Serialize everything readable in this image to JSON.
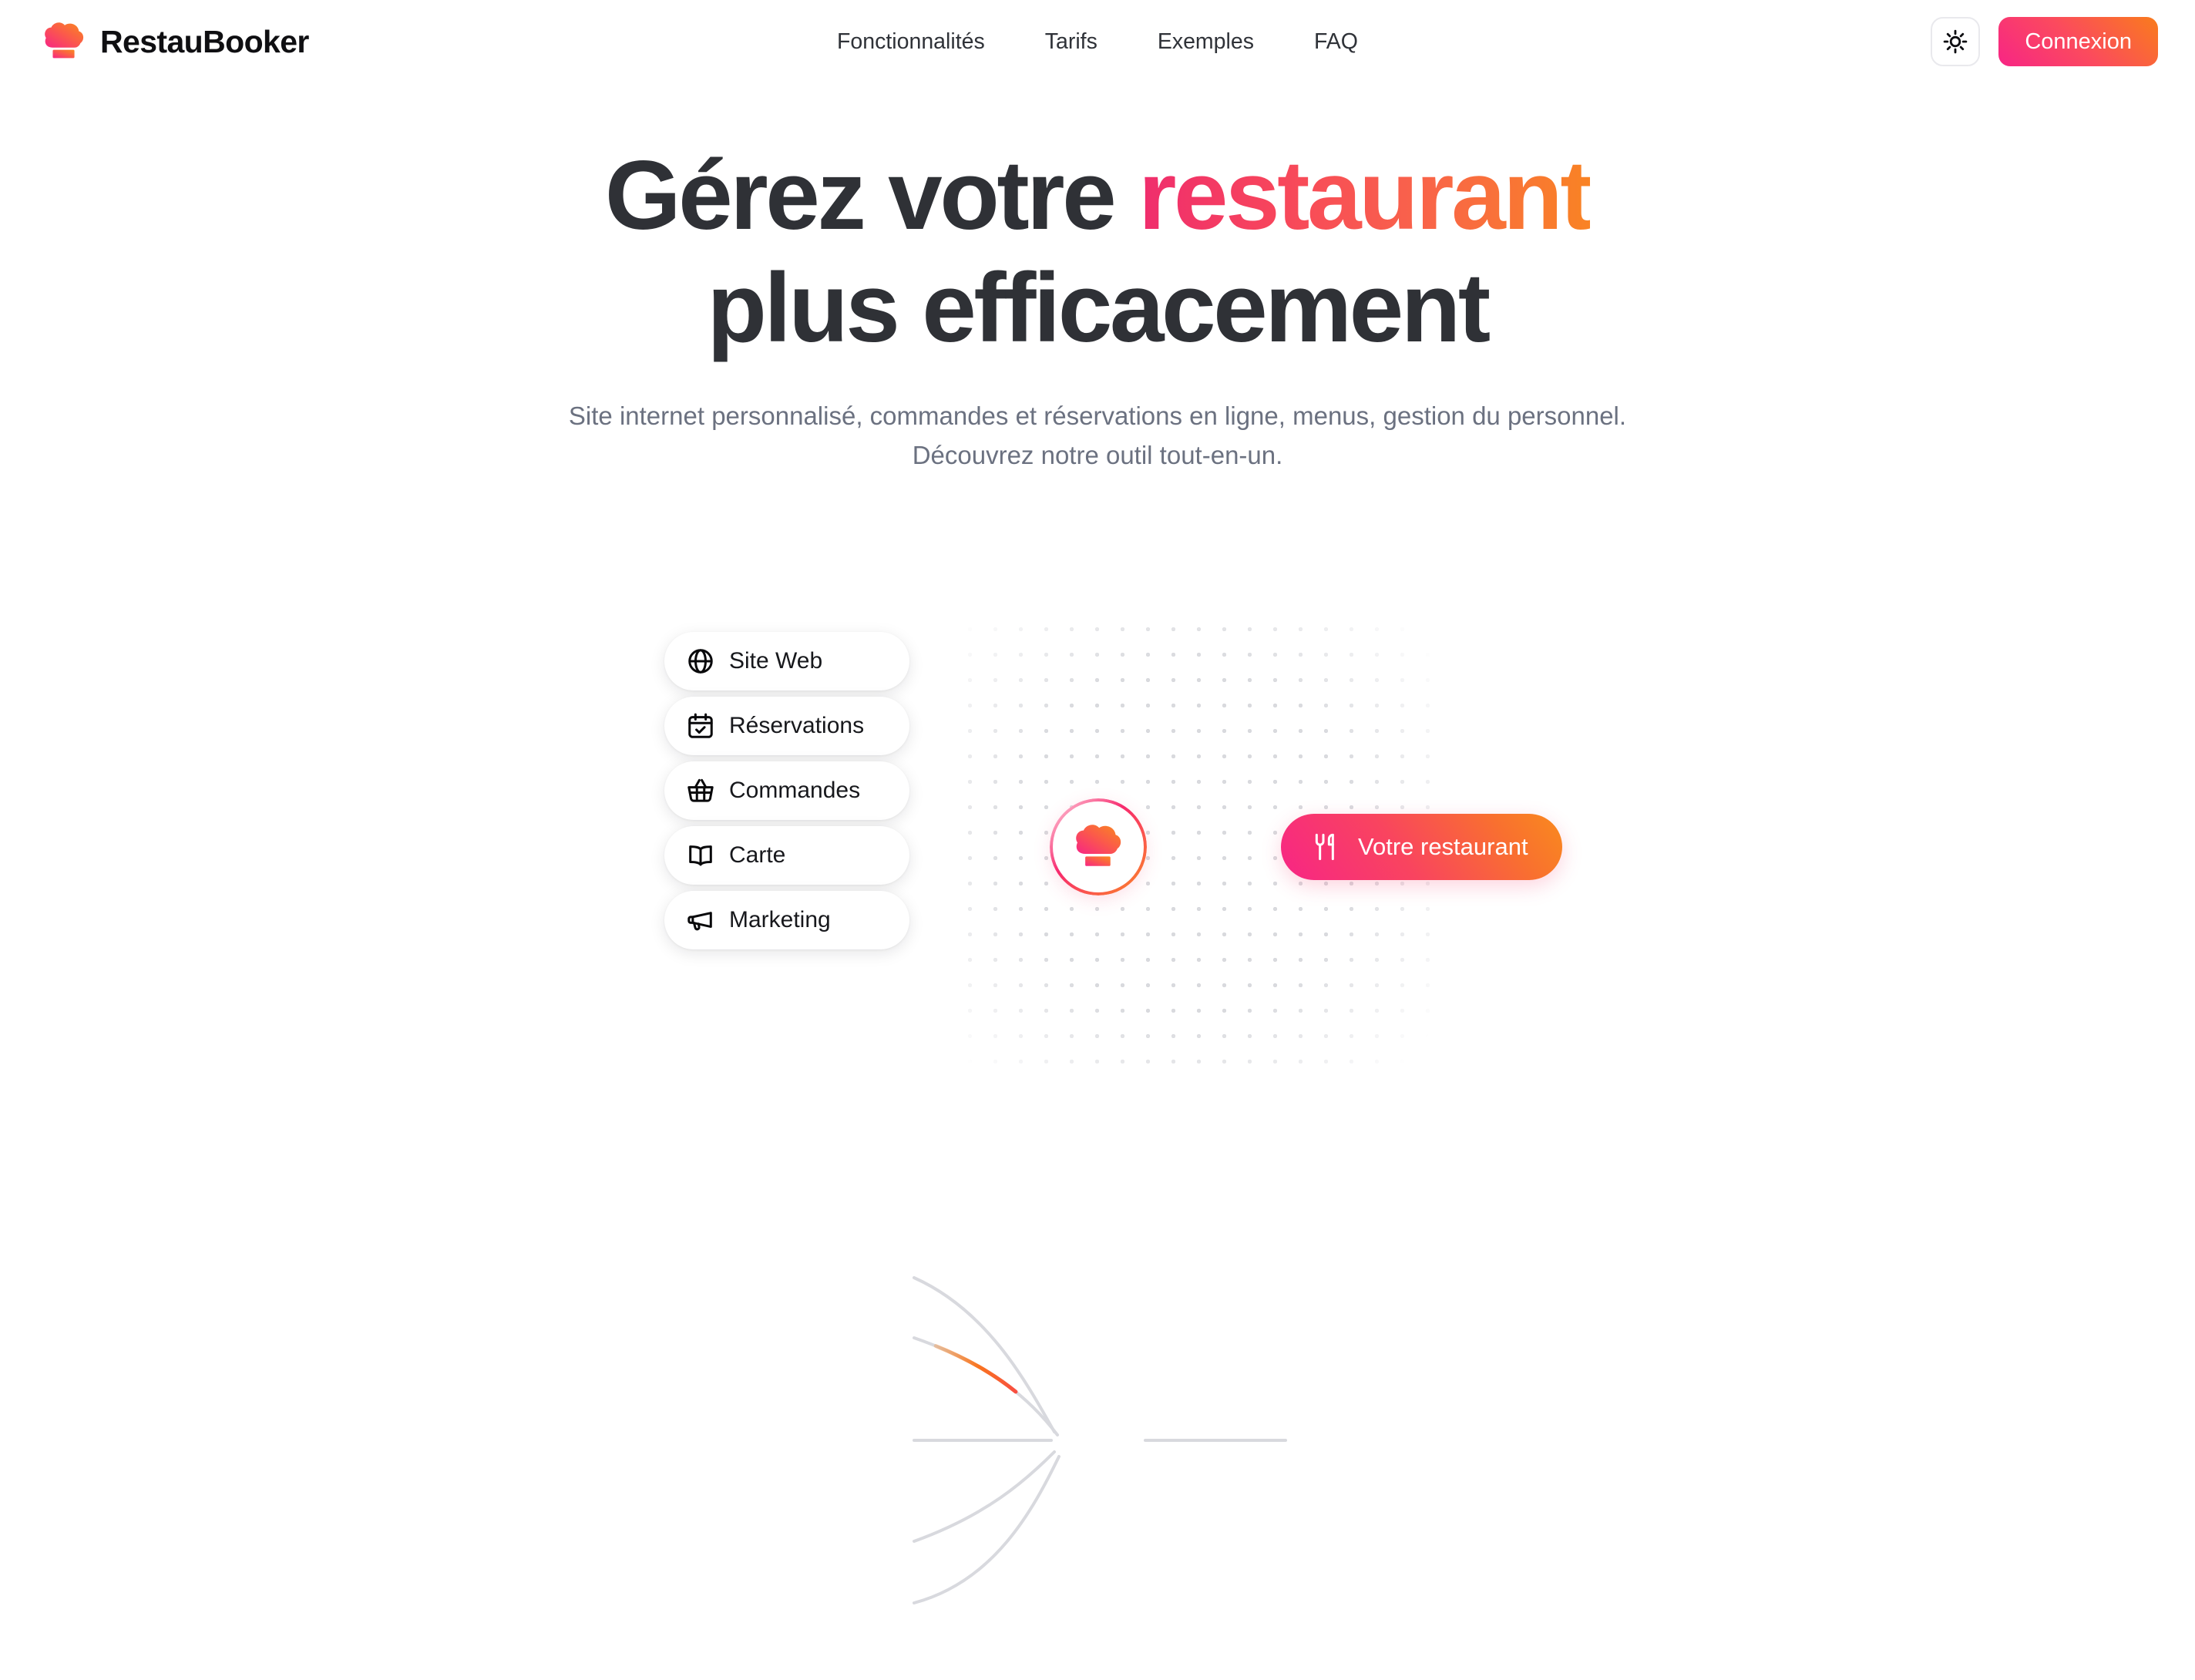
{
  "brand": {
    "name": "RestauBooker",
    "logo_icon": "chef-hat-icon"
  },
  "nav": {
    "links": [
      {
        "label": "Fonctionnalités"
      },
      {
        "label": "Tarifs"
      },
      {
        "label": "Exemples"
      },
      {
        "label": "FAQ"
      }
    ]
  },
  "header_actions": {
    "theme_toggle_icon": "sun-icon",
    "login_label": "Connexion"
  },
  "hero": {
    "title_part1": "Gérez votre ",
    "title_highlight": "restaurant",
    "title_part2": "plus efficacement",
    "subtitle_line1": "Site internet personnalisé, commandes et réservations en ligne, menus, gestion du personnel.",
    "subtitle_line2": "Découvrez notre outil tout-en-un."
  },
  "diagram": {
    "features": [
      {
        "label": "Site Web",
        "icon": "globe-icon"
      },
      {
        "label": "Réservations",
        "icon": "calendar-check-icon"
      },
      {
        "label": "Commandes",
        "icon": "shopping-basket-icon"
      },
      {
        "label": "Carte",
        "icon": "open-book-icon"
      },
      {
        "label": "Marketing",
        "icon": "megaphone-icon"
      }
    ],
    "hub": {
      "icon": "chef-hat-icon"
    },
    "target": {
      "label": "Votre restaurant",
      "icon": "fork-knife-icon"
    }
  },
  "colors": {
    "brand_pink": "#f72585",
    "brand_orange": "#f97316",
    "text_dark": "#2f3136",
    "text_muted": "#6b7180",
    "edge_gray": "#d8d9de"
  }
}
